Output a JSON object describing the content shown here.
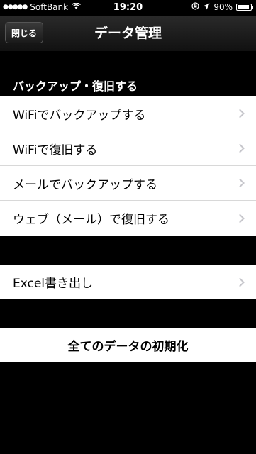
{
  "status_bar": {
    "signal": "●●●●●",
    "carrier": "SoftBank",
    "time": "19:20",
    "battery_percent": "90%",
    "battery_level": 0.9
  },
  "nav": {
    "back_label": "閉じる",
    "title": "データ管理"
  },
  "sections": {
    "backup_header": "バックアップ・復旧する",
    "backup_items": [
      "WiFiでバックアップする",
      "WiFiで復旧する",
      "メールでバックアップする",
      "ウェブ（メール）で復旧する"
    ],
    "export_item": "Excel書き出し",
    "reset_item": "全てのデータの初期化"
  },
  "colors": {
    "background": "#000000",
    "cell": "#ffffff",
    "chevron": "#c7c7cc"
  }
}
